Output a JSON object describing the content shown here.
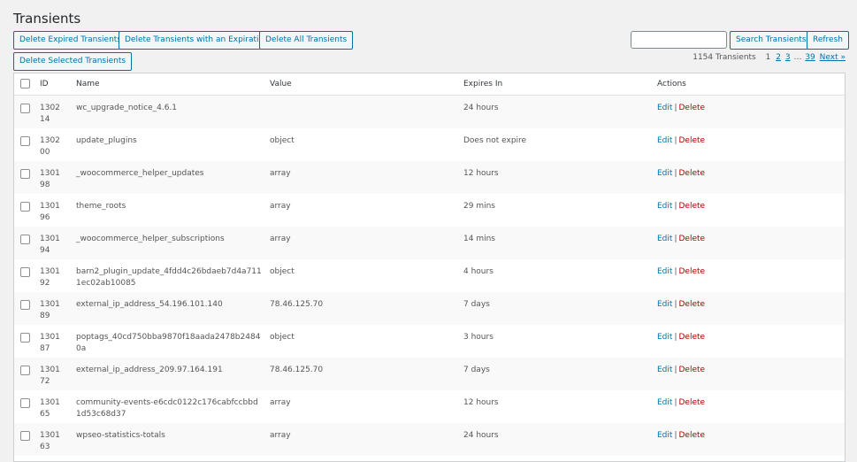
{
  "page": {
    "title": "Transients"
  },
  "toolbar": {
    "delete_expired": "Delete Expired Transients",
    "delete_with_expiration": "Delete Transients with an Expiration",
    "delete_all": "Delete All Transients",
    "delete_selected": "Delete Selected Transients",
    "search_button": "Search Transients",
    "refresh_button": "Refresh",
    "search_value": ""
  },
  "pagination": {
    "count": "1154 Transients",
    "current": "1",
    "pages": [
      "2",
      "3"
    ],
    "ellipsis": "…",
    "last": "39",
    "next": "Next »"
  },
  "table": {
    "headers": {
      "id": "ID",
      "name": "Name",
      "value": "Value",
      "expires": "Expires In",
      "actions": "Actions"
    },
    "action_labels": {
      "edit": "Edit",
      "sep": "|",
      "delete": "Delete"
    },
    "rows": [
      {
        "id": "130214",
        "name": "wc_upgrade_notice_4.6.1",
        "value": "",
        "expires": "24 hours"
      },
      {
        "id": "130200",
        "name": "update_plugins",
        "value": "object",
        "expires": "Does not expire"
      },
      {
        "id": "130198",
        "name": "_woocommerce_helper_updates",
        "value": "array",
        "expires": "12 hours"
      },
      {
        "id": "130196",
        "name": "theme_roots",
        "value": "array",
        "expires": "29 mins"
      },
      {
        "id": "130194",
        "name": "_woocommerce_helper_subscriptions",
        "value": "array",
        "expires": "14 mins"
      },
      {
        "id": "130192",
        "name": "barn2_plugin_update_4fdd4c26bdaeb7d4a7111ec02ab10085",
        "value": "object",
        "expires": "4 hours"
      },
      {
        "id": "130189",
        "name": "external_ip_address_54.196.101.140",
        "value": "78.46.125.70",
        "expires": "7 days"
      },
      {
        "id": "130187",
        "name": "poptags_40cd750bba9870f18aada2478b24840a",
        "value": "object",
        "expires": "3 hours"
      },
      {
        "id": "130172",
        "name": "external_ip_address_209.97.164.191",
        "value": "78.46.125.70",
        "expires": "7 days"
      },
      {
        "id": "130165",
        "name": "community-events-e6cdc0122c176cabfccbbd1d53c68d37",
        "value": "array",
        "expires": "12 hours"
      },
      {
        "id": "130163",
        "name": "wpseo-statistics-totals",
        "value": "array",
        "expires": "24 hours"
      }
    ]
  }
}
